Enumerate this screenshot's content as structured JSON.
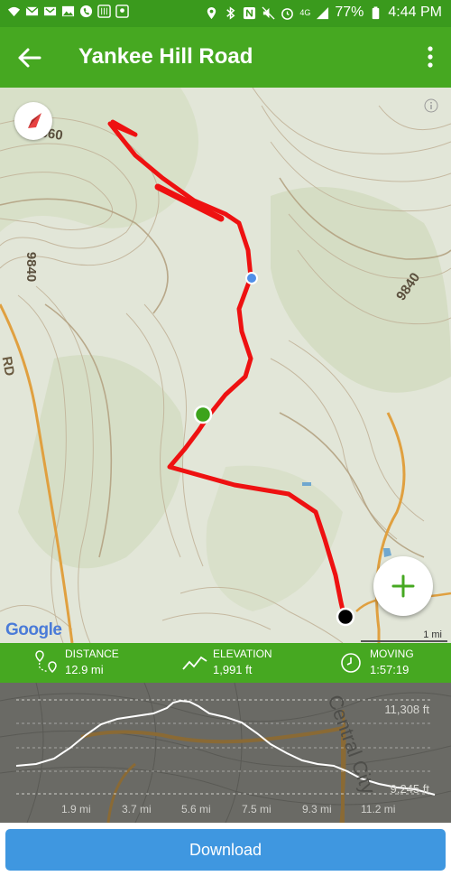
{
  "status_bar": {
    "battery": "77%",
    "time": "4:44 PM"
  },
  "app_bar": {
    "title": "Yankee Hill Road"
  },
  "map": {
    "contour_labels": [
      "10660",
      "9840",
      "9840"
    ],
    "road_label": "RD",
    "attribution": "Google",
    "scale": "1 mi"
  },
  "stats": {
    "distance": {
      "label": "DISTANCE",
      "value": "12.9 mi"
    },
    "elevation": {
      "label": "ELEVATION",
      "value": "1,991 ft"
    },
    "moving": {
      "label": "MOVING",
      "value": "1:57:19"
    }
  },
  "elevation_profile": {
    "max_label": "11,308 ft",
    "min_label": "9,245 ft",
    "overlay_text": "Central City",
    "x_ticks": [
      "1.9 mi",
      "3.7 mi",
      "5.6 mi",
      "7.5 mi",
      "9.3 mi",
      "11.2 mi"
    ]
  },
  "download_label": "Download",
  "colors": {
    "brand_green": "#46a821",
    "status_green": "#3a9a1d",
    "route_red": "#ee1111",
    "button_blue": "#3f97e0"
  }
}
